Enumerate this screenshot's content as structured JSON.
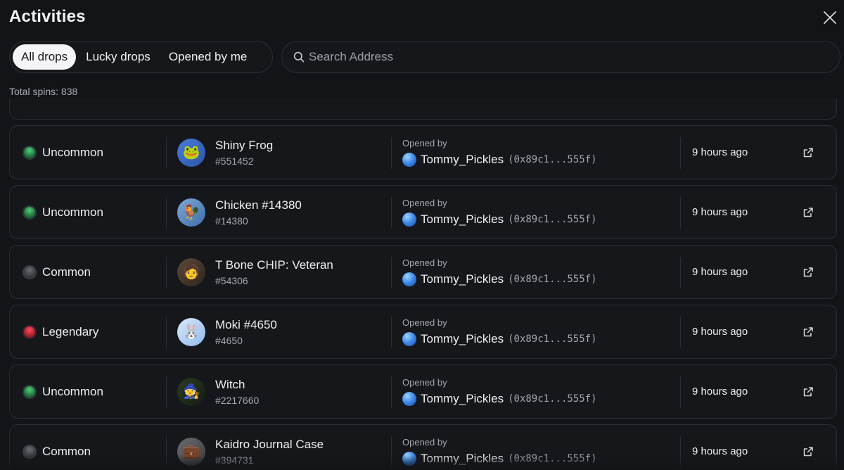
{
  "header": {
    "title": "Activities"
  },
  "tabs": [
    {
      "label": "All drops",
      "active": true
    },
    {
      "label": "Lucky drops",
      "active": false
    },
    {
      "label": "Opened by me",
      "active": false
    }
  ],
  "search": {
    "placeholder": "Search Address",
    "value": ""
  },
  "summary": {
    "total_spins": "Total spins: 838"
  },
  "colors": {
    "background": "#121418",
    "uncommon": "#2fb35e",
    "common": "#55585d",
    "legendary": "#d92c3d",
    "tab_active_bg": "#f5f5f7"
  },
  "rows": [
    {
      "rarity": "Uncommon",
      "rarity_class": "uncommon",
      "item_name": "Shiny Frog",
      "item_id": "#551452",
      "thumb_icon": "frog-icon",
      "opened_label": "Opened by",
      "user": "Tommy_Pickles",
      "address": "(0x89c1...555f)",
      "time": "9 hours ago"
    },
    {
      "rarity": "Uncommon",
      "rarity_class": "uncommon",
      "item_name": "Chicken #14380",
      "item_id": "#14380",
      "thumb_icon": "chicken-icon",
      "opened_label": "Opened by",
      "user": "Tommy_Pickles",
      "address": "(0x89c1...555f)",
      "time": "9 hours ago"
    },
    {
      "rarity": "Common",
      "rarity_class": "common",
      "item_name": "T Bone CHIP: Veteran",
      "item_id": "#54306",
      "thumb_icon": "character-icon",
      "opened_label": "Opened by",
      "user": "Tommy_Pickles",
      "address": "(0x89c1...555f)",
      "time": "9 hours ago"
    },
    {
      "rarity": "Legendary",
      "rarity_class": "legendary",
      "item_name": "Moki #4650",
      "item_id": "#4650",
      "thumb_icon": "moki-icon",
      "opened_label": "Opened by",
      "user": "Tommy_Pickles",
      "address": "(0x89c1...555f)",
      "time": "9 hours ago"
    },
    {
      "rarity": "Uncommon",
      "rarity_class": "uncommon",
      "item_name": "Witch",
      "item_id": "#2217660",
      "thumb_icon": "witch-icon",
      "opened_label": "Opened by",
      "user": "Tommy_Pickles",
      "address": "(0x89c1...555f)",
      "time": "9 hours ago"
    },
    {
      "rarity": "Common",
      "rarity_class": "common",
      "item_name": "Kaidro Journal Case",
      "item_id": "#394731",
      "thumb_icon": "journal-case-icon",
      "opened_label": "Opened by",
      "user": "Tommy_Pickles",
      "address": "(0x89c1...555f)",
      "time": "9 hours ago"
    }
  ]
}
